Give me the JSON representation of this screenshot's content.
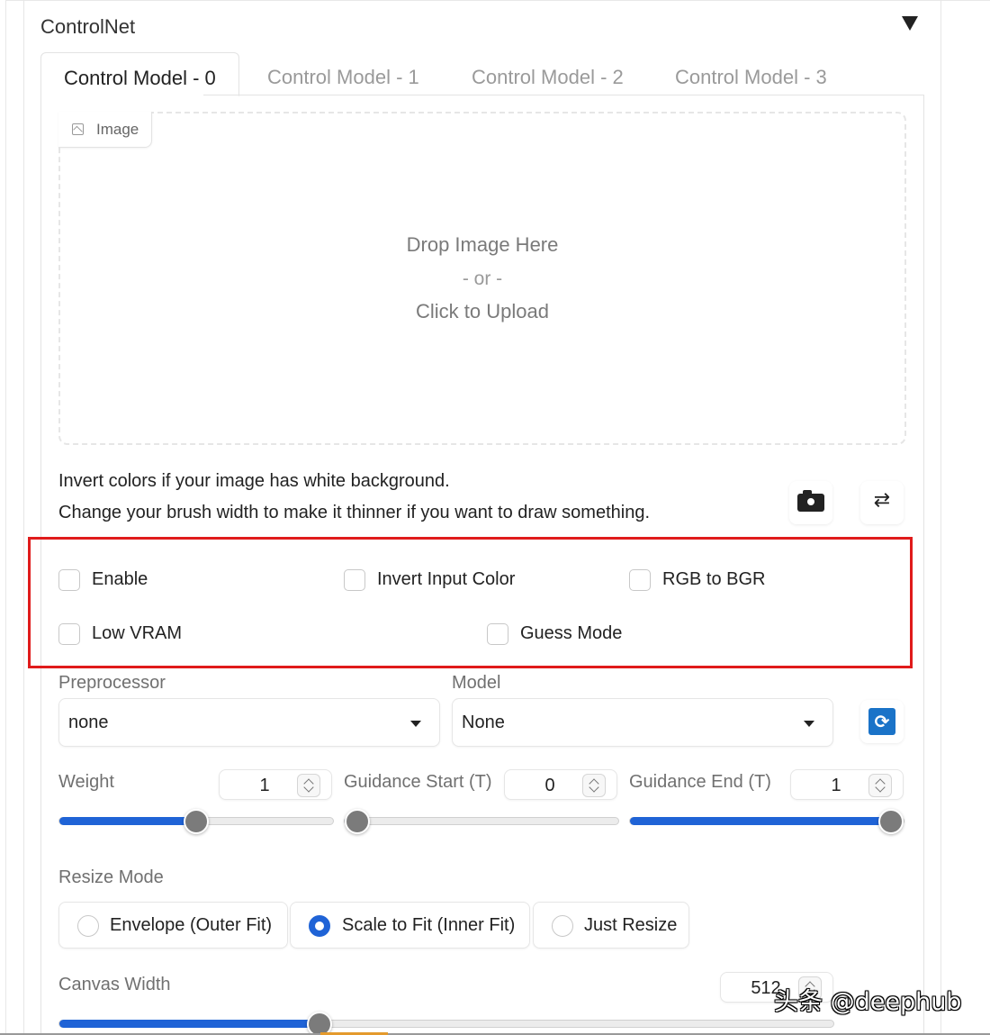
{
  "panel": {
    "title": "ControlNet"
  },
  "tabs": [
    {
      "label": "Control Model - 0",
      "active": true
    },
    {
      "label": "Control Model - 1",
      "active": false
    },
    {
      "label": "Control Model - 2",
      "active": false
    },
    {
      "label": "Control Model - 3",
      "active": false
    }
  ],
  "image_input": {
    "chip_label": "Image",
    "chip_icon": "image-icon",
    "drop_line1": "Drop Image Here",
    "drop_line2": "- or -",
    "drop_line3": "Click to Upload"
  },
  "hints": {
    "line1": "Invert colors if your image has white background.",
    "line2": "Change your brush width to make it thinner if you want to draw something."
  },
  "tool_icons": {
    "camera": "camera-icon",
    "swap": "swap-icon",
    "refresh": "refresh-icon"
  },
  "checkboxes": {
    "enable": {
      "label": "Enable",
      "checked": false
    },
    "invert_input_color": {
      "label": "Invert Input Color",
      "checked": false
    },
    "rgb_to_bgr": {
      "label": "RGB to BGR",
      "checked": false
    },
    "low_vram": {
      "label": "Low VRAM",
      "checked": false
    },
    "guess_mode": {
      "label": "Guess Mode",
      "checked": false
    }
  },
  "preprocessor": {
    "label": "Preprocessor",
    "value": "none"
  },
  "model": {
    "label": "Model",
    "value": "None"
  },
  "weight": {
    "label": "Weight",
    "value": "1",
    "fraction": 0.5
  },
  "guidance_start": {
    "label": "Guidance Start (T)",
    "value": "0",
    "fraction": 0.0
  },
  "guidance_end": {
    "label": "Guidance End (T)",
    "value": "1",
    "fraction": 1.0
  },
  "resize_mode": {
    "label": "Resize Mode",
    "options": [
      {
        "label": "Envelope (Outer Fit)",
        "selected": false
      },
      {
        "label": "Scale to Fit (Inner Fit)",
        "selected": true
      },
      {
        "label": "Just Resize",
        "selected": false
      }
    ]
  },
  "canvas_width": {
    "label": "Canvas Width",
    "value": "512",
    "fraction": 0.33
  },
  "watermark": "头条 @deephub",
  "colors": {
    "accent": "#1f63d6",
    "highlight_box": "#e01b1b",
    "thumb": "#7b7b7b"
  }
}
